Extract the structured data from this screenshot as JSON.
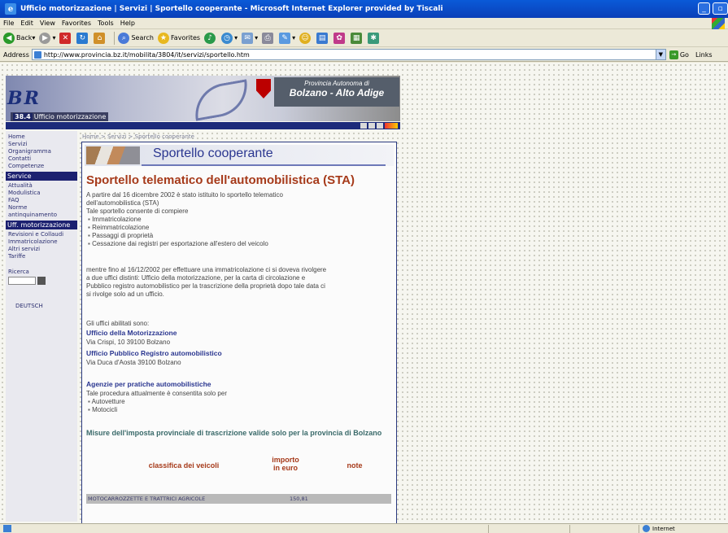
{
  "window": {
    "title": "Ufficio motorizzazione | Servizi | Sportello cooperante - Microsoft Internet Explorer provided by Tiscali"
  },
  "menu": [
    "File",
    "Edit",
    "View",
    "Favorites",
    "Tools",
    "Help"
  ],
  "toolbar": {
    "back": "Back",
    "search": "Search",
    "favorites": "Favorites"
  },
  "address": {
    "label": "Address",
    "url": "http://www.provincia.bz.it/mobilita/3804/it/servizi/sportello.htm",
    "go": "Go",
    "links": "Links"
  },
  "banner": {
    "logo": "BR",
    "prov_small": "Provincia Autonoma di",
    "prov_big": "Bolzano - Alto Adige",
    "office_num": "38.4",
    "office": "Ufficio motorizzazione"
  },
  "nav": {
    "top_links": [
      "Home",
      "Servizi",
      "Organigramma",
      "Contatti",
      "Competenze"
    ],
    "service_header": "Service",
    "service_links": [
      "Attualità",
      "Modulistica",
      "FAQ",
      "Norme antinquinamento"
    ],
    "uff_header": "Uff. motorizzazione",
    "uff_links": [
      "Revisioni e Collaudi",
      "Immatricolazione",
      "Altri servizi",
      "Tariffe"
    ],
    "search_label": "Ricerca",
    "deutsch": "DEUTSCH"
  },
  "main": {
    "breadcrumb": "Home > Servizi > Sportello cooperante",
    "banner_title": "Sportello cooperante",
    "heading": "Sportello telematico dell'automobilistica (STA)",
    "intro_1": "A partire dal 16 dicembre 2002 è stato istituito lo sportello telematico",
    "intro_2": "dell'automobilistica (STA)",
    "intro_3": "Tale sportello consente di compiere",
    "bullets": [
      "Immatricolazione",
      "Reimmatricolazione",
      "Passaggi di proprietà",
      "Cessazione dai registri per esportazione all'estero del veicolo"
    ],
    "para2_1": "mentre fino al 16/12/2002 per effettuare una immatricolazione ci si doveva rivolgere",
    "para2_2": "a due uffici distinti: Ufficio della motorizzazione, per la carta di circolazione e",
    "para2_3": "Pubblico registro automobilistico per la trascrizione della proprietà dopo tale data ci",
    "para2_4": "si rivolge solo ad un ufficio.",
    "offices_label": "Gli uffici abilitati sono:",
    "office1_name": "Ufficio della Motorizzazione",
    "office1_addr": "Via Crispi, 10 39100 Bolzano",
    "office2_name": "Ufficio Pubblico Registro automobilistico",
    "office2_addr": "Via Duca d'Aosta 39100 Bolzano",
    "agencies_head": "Agenzie per pratiche automobilistiche",
    "agencies_text": "Tale procedura attualmente è consentita solo per",
    "agencies_bullets": [
      "Autovetture",
      "Motocicli"
    ],
    "measures_head": "Misure dell'imposta provinciale di trascrizione valide solo per la provincia di Bolzano",
    "table": {
      "col1": "classifica dei veicoli",
      "col2": "importo in euro",
      "col3": "note",
      "row1_c1": "MOTOCARROZZETTE E TRATTRICI AGRICOLE",
      "row1_c2": "150,81"
    }
  },
  "status": {
    "zone": "Internet"
  }
}
